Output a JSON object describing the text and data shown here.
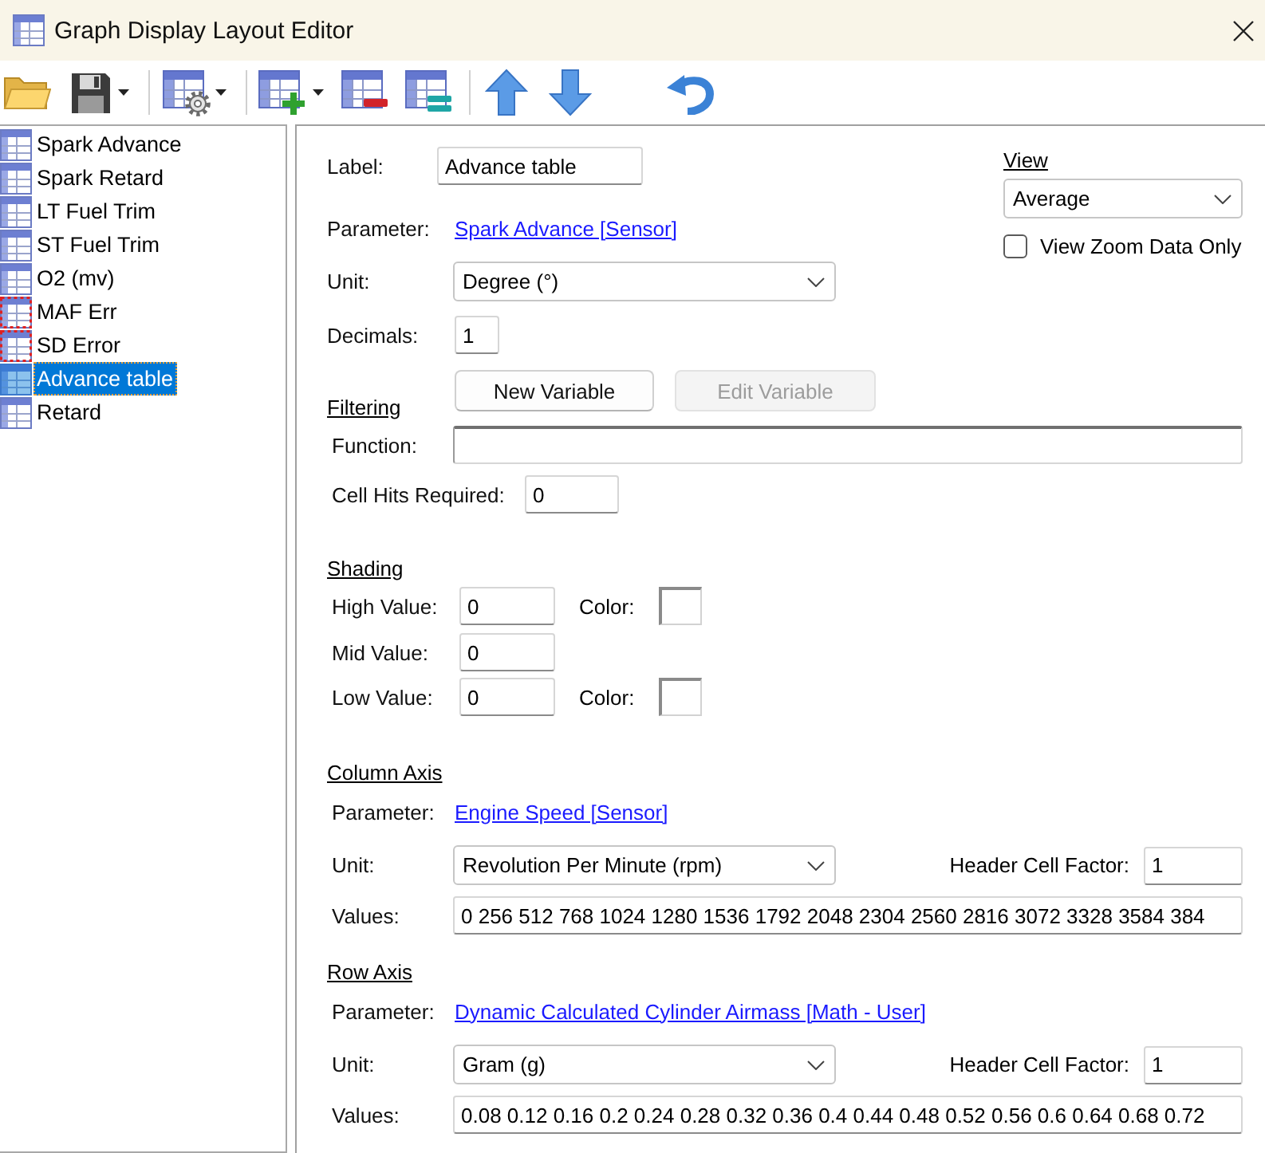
{
  "window": {
    "title": "Graph Display Layout Editor"
  },
  "sidebar": {
    "items": [
      {
        "label": "Spark Advance",
        "selected": false,
        "flagged": false
      },
      {
        "label": "Spark Retard",
        "selected": false,
        "flagged": false
      },
      {
        "label": "LT Fuel Trim",
        "selected": false,
        "flagged": false
      },
      {
        "label": "ST Fuel Trim",
        "selected": false,
        "flagged": false
      },
      {
        "label": "O2 (mv)",
        "selected": false,
        "flagged": false
      },
      {
        "label": "MAF Err",
        "selected": false,
        "flagged": true
      },
      {
        "label": "SD Error",
        "selected": false,
        "flagged": true
      },
      {
        "label": "Advance table",
        "selected": true,
        "flagged": false
      },
      {
        "label": "Retard",
        "selected": false,
        "flagged": false
      }
    ]
  },
  "form": {
    "label_field": {
      "label": "Label:",
      "value": "Advance table"
    },
    "parameter": {
      "label": "Parameter:",
      "link": "Spark Advance [Sensor]"
    },
    "unit": {
      "label": "Unit:",
      "value": "Degree (°)"
    },
    "decimals": {
      "label": "Decimals:",
      "value": "1"
    }
  },
  "view": {
    "heading": "View",
    "value": "Average",
    "zoom_only": {
      "label": "View Zoom Data Only",
      "checked": false
    }
  },
  "filtering": {
    "heading": "Filtering",
    "buttons": [
      {
        "label": "New Variable",
        "disabled": false
      },
      {
        "label": "Edit Variable",
        "disabled": true
      }
    ],
    "function": {
      "label": "Function:"
    },
    "cell_hits": {
      "label": "Cell Hits Required:",
      "value": "0"
    }
  },
  "shading": {
    "heading": "Shading",
    "rows": [
      {
        "label": "High Value:",
        "value": "0",
        "color_label": "Color:"
      },
      {
        "label": "Mid Value:",
        "value": "0"
      },
      {
        "label": "Low Value:",
        "value": "0",
        "color_label": "Color:"
      }
    ]
  },
  "column_axis": {
    "heading": "Column Axis",
    "parameter_label": "Parameter:",
    "parameter": "Engine Speed [Sensor]",
    "unit_label": "Unit:",
    "unit": "Revolution Per Minute (rpm)",
    "factor_label": "Header Cell Factor:",
    "factor": "1",
    "values_label": "Values:",
    "values": "0 256 512 768 1024 1280 1536 1792 2048 2304 2560 2816 3072 3328 3584 384"
  },
  "row_axis": {
    "heading": "Row Axis",
    "parameter_label": "Parameter:",
    "parameter": "Dynamic Calculated Cylinder Airmass [Math - User]",
    "unit_label": "Unit:",
    "unit": "Gram (g)",
    "factor_label": "Header Cell Factor:",
    "factor": "1",
    "values_label": "Values:",
    "values": "0.08 0.12 0.16 0.2 0.24 0.28 0.32 0.36 0.4 0.44 0.48 0.52 0.56 0.6 0.64 0.68 0.72"
  }
}
